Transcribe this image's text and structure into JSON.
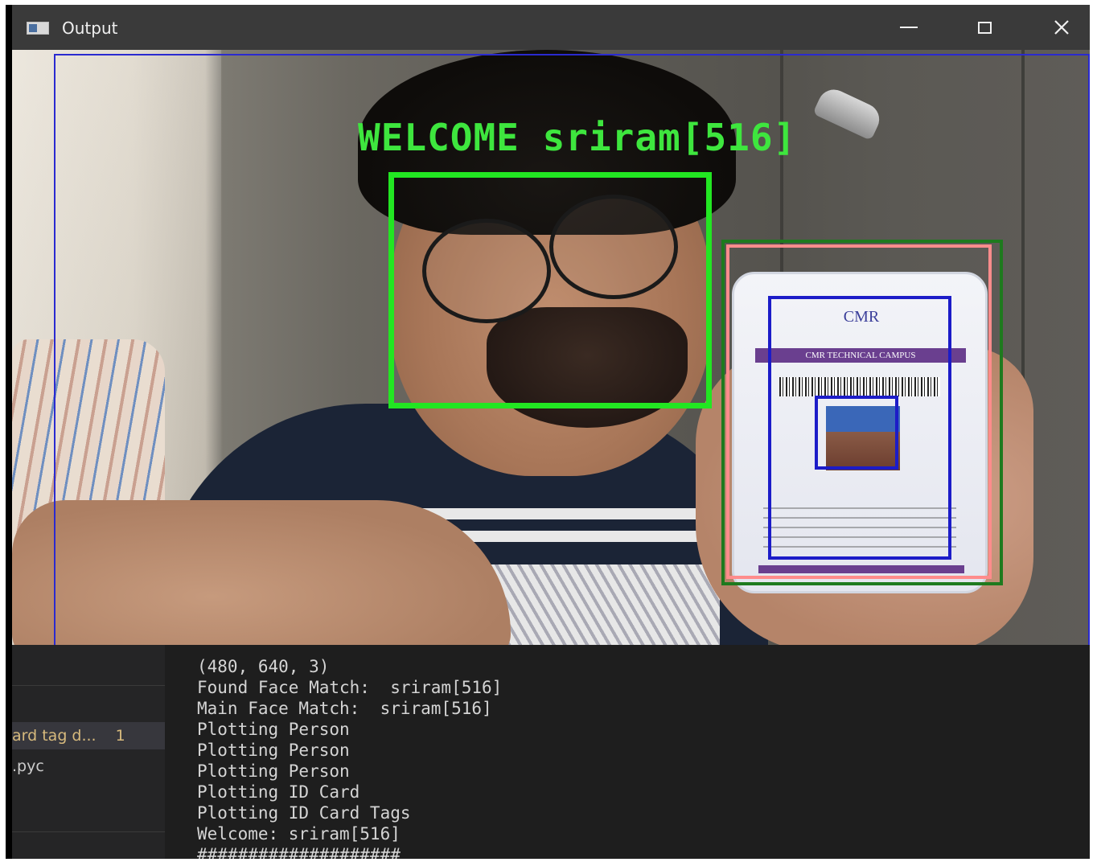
{
  "window": {
    "title": "Output",
    "icon": "window-app-icon",
    "controls": {
      "minimize": "minimize-icon",
      "maximize": "maximize-icon",
      "close": "close-icon"
    }
  },
  "overlay": {
    "welcome_prefix": "WELCOME",
    "welcome_name": "sriram[516]",
    "colors": {
      "face_box": "#22e622",
      "card_box_outer": "#1e7a1e",
      "card_box_inner": "#ff8c8c",
      "tag_box": "#1c1cc8",
      "frame_box": "#2a2ad0",
      "welcome_text": "#3ee63e"
    }
  },
  "id_card": {
    "logo": "CMR",
    "college": "CMR TECHNICAL CAMPUS"
  },
  "side_panel": {
    "items": [
      {
        "label": "ard tag d...",
        "badge": "1",
        "selected": true
      },
      {
        "label": ".pyc",
        "selected": false
      }
    ]
  },
  "console": {
    "lines": [
      "(480, 640, 3)",
      "Found Face Match:  sriram[516]",
      "Main Face Match:  sriram[516]",
      "Plotting Person",
      "Plotting Person",
      "Plotting Person",
      "Plotting ID Card",
      "Plotting ID Card Tags",
      "Welcome: sriram[516]",
      "####################"
    ]
  }
}
